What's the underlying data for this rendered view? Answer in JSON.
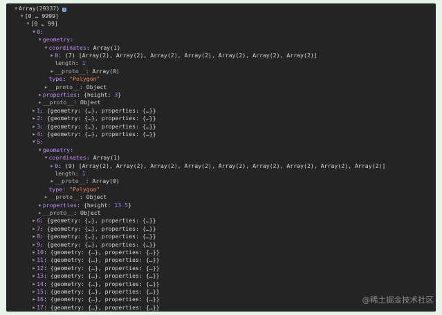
{
  "root_label": "Array(29337)",
  "watermark": "@稀土掘金技术社区",
  "rows": [
    {
      "ind": 0,
      "tri": "open",
      "spans": [
        {
          "t": "Array(29337)",
          "c": "key"
        }
      ],
      "icon": true
    },
    {
      "ind": 1,
      "tri": "open",
      "spans": [
        {
          "t": "[0 … 9999]",
          "c": "key"
        }
      ]
    },
    {
      "ind": 2,
      "tri": "open",
      "spans": [
        {
          "t": "[0 … 99]",
          "c": "key"
        }
      ]
    },
    {
      "ind": 3,
      "tri": "open",
      "spans": [
        {
          "t": "0:",
          "c": "purple"
        }
      ]
    },
    {
      "ind": 4,
      "tri": "open",
      "spans": [
        {
          "t": "geometry:",
          "c": "purple"
        }
      ]
    },
    {
      "ind": 5,
      "tri": "open",
      "spans": [
        {
          "t": "coordinates",
          "c": "purple"
        },
        {
          "t": ": Array(1)",
          "c": "key"
        }
      ]
    },
    {
      "ind": 6,
      "tri": "closed",
      "spans": [
        {
          "t": "0",
          "c": "purple"
        },
        {
          "t": ": (7) [Array(2), Array(2), Array(2), Array(2), Array(2), Array(2), Array(2)]",
          "c": "key"
        }
      ]
    },
    {
      "ind": 6,
      "tri": "none",
      "spans": [
        {
          "t": "length",
          "c": "dim"
        },
        {
          "t": ": ",
          "c": "key"
        },
        {
          "t": "1",
          "c": "num"
        }
      ]
    },
    {
      "ind": 6,
      "tri": "closed",
      "spans": [
        {
          "t": "__proto__",
          "c": "dim"
        },
        {
          "t": ": Array(0)",
          "c": "key"
        }
      ]
    },
    {
      "ind": 5,
      "tri": "none",
      "spans": [
        {
          "t": "type",
          "c": "purple"
        },
        {
          "t": ": ",
          "c": "key"
        },
        {
          "t": "\"Polygon\"",
          "c": "str"
        }
      ]
    },
    {
      "ind": 5,
      "tri": "closed",
      "spans": [
        {
          "t": "__proto__",
          "c": "dim"
        },
        {
          "t": ": Object",
          "c": "key"
        }
      ]
    },
    {
      "ind": 4,
      "tri": "closed",
      "spans": [
        {
          "t": "properties",
          "c": "purple"
        },
        {
          "t": ": {height: ",
          "c": "key"
        },
        {
          "t": "3",
          "c": "num"
        },
        {
          "t": "}",
          "c": "key"
        }
      ]
    },
    {
      "ind": 4,
      "tri": "closed",
      "spans": [
        {
          "t": "__proto__",
          "c": "dim"
        },
        {
          "t": ": Object",
          "c": "key"
        }
      ]
    },
    {
      "ind": 3,
      "tri": "closed",
      "spans": [
        {
          "t": "1",
          "c": "purple"
        },
        {
          "t": ": {geometry: {…}, properties: {…}}",
          "c": "key"
        }
      ]
    },
    {
      "ind": 3,
      "tri": "closed",
      "spans": [
        {
          "t": "2",
          "c": "purple"
        },
        {
          "t": ": {geometry: {…}, properties: {…}}",
          "c": "key"
        }
      ]
    },
    {
      "ind": 3,
      "tri": "closed",
      "spans": [
        {
          "t": "3",
          "c": "purple"
        },
        {
          "t": ": {geometry: {…}, properties: {…}}",
          "c": "key"
        }
      ]
    },
    {
      "ind": 3,
      "tri": "closed",
      "spans": [
        {
          "t": "4",
          "c": "purple"
        },
        {
          "t": ": {geometry: {…}, properties: {…}}",
          "c": "key"
        }
      ]
    },
    {
      "ind": 3,
      "tri": "open",
      "spans": [
        {
          "t": "5:",
          "c": "purple"
        }
      ]
    },
    {
      "ind": 4,
      "tri": "open",
      "spans": [
        {
          "t": "geometry:",
          "c": "purple"
        }
      ]
    },
    {
      "ind": 5,
      "tri": "open",
      "spans": [
        {
          "t": "coordinates",
          "c": "purple"
        },
        {
          "t": ": Array(1)",
          "c": "key"
        }
      ]
    },
    {
      "ind": 6,
      "tri": "closed",
      "spans": [
        {
          "t": "0",
          "c": "purple"
        },
        {
          "t": ": (9) [Array(2), Array(2), Array(2), Array(2), Array(2), Array(2), Array(2), Array(2), Array(2)]",
          "c": "key"
        }
      ]
    },
    {
      "ind": 6,
      "tri": "none",
      "spans": [
        {
          "t": "length",
          "c": "dim"
        },
        {
          "t": ": ",
          "c": "key"
        },
        {
          "t": "1",
          "c": "num"
        }
      ]
    },
    {
      "ind": 6,
      "tri": "closed",
      "spans": [
        {
          "t": "__proto__",
          "c": "dim"
        },
        {
          "t": ": Array(0)",
          "c": "key"
        }
      ]
    },
    {
      "ind": 5,
      "tri": "none",
      "spans": [
        {
          "t": "type",
          "c": "purple"
        },
        {
          "t": ": ",
          "c": "key"
        },
        {
          "t": "\"Polygon\"",
          "c": "str"
        }
      ]
    },
    {
      "ind": 5,
      "tri": "closed",
      "spans": [
        {
          "t": "__proto__",
          "c": "dim"
        },
        {
          "t": ": Object",
          "c": "key"
        }
      ]
    },
    {
      "ind": 4,
      "tri": "closed",
      "spans": [
        {
          "t": "properties",
          "c": "purple"
        },
        {
          "t": ": {height: ",
          "c": "key"
        },
        {
          "t": "13.5",
          "c": "num"
        },
        {
          "t": "}",
          "c": "key"
        }
      ]
    },
    {
      "ind": 4,
      "tri": "closed",
      "spans": [
        {
          "t": "__proto__",
          "c": "dim"
        },
        {
          "t": ": Object",
          "c": "key"
        }
      ]
    },
    {
      "ind": 3,
      "tri": "closed",
      "spans": [
        {
          "t": "6",
          "c": "purple"
        },
        {
          "t": ": {geometry: {…}, properties: {…}}",
          "c": "key"
        }
      ]
    },
    {
      "ind": 3,
      "tri": "closed",
      "spans": [
        {
          "t": "7",
          "c": "purple"
        },
        {
          "t": ": {geometry: {…}, properties: {…}}",
          "c": "key"
        }
      ]
    },
    {
      "ind": 3,
      "tri": "closed",
      "spans": [
        {
          "t": "8",
          "c": "purple"
        },
        {
          "t": ": {geometry: {…}, properties: {…}}",
          "c": "key"
        }
      ]
    },
    {
      "ind": 3,
      "tri": "closed",
      "spans": [
        {
          "t": "9",
          "c": "purple"
        },
        {
          "t": ": {geometry: {…}, properties: {…}}",
          "c": "key"
        }
      ]
    },
    {
      "ind": 3,
      "tri": "closed",
      "spans": [
        {
          "t": "10",
          "c": "purple"
        },
        {
          "t": ": {geometry: {…}, properties: {…}}",
          "c": "key"
        }
      ]
    },
    {
      "ind": 3,
      "tri": "closed",
      "spans": [
        {
          "t": "11",
          "c": "purple"
        },
        {
          "t": ": {geometry: {…}, properties: {…}}",
          "c": "key"
        }
      ]
    },
    {
      "ind": 3,
      "tri": "closed",
      "spans": [
        {
          "t": "12",
          "c": "purple"
        },
        {
          "t": ": {geometry: {…}, properties: {…}}",
          "c": "key"
        }
      ]
    },
    {
      "ind": 3,
      "tri": "closed",
      "spans": [
        {
          "t": "13",
          "c": "purple"
        },
        {
          "t": ": {geometry: {…}, properties: {…}}",
          "c": "key"
        }
      ]
    },
    {
      "ind": 3,
      "tri": "closed",
      "spans": [
        {
          "t": "14",
          "c": "purple"
        },
        {
          "t": ": {geometry: {…}, properties: {…}}",
          "c": "key"
        }
      ]
    },
    {
      "ind": 3,
      "tri": "closed",
      "spans": [
        {
          "t": "15",
          "c": "purple"
        },
        {
          "t": ": {geometry: {…}, properties: {…}}",
          "c": "key"
        }
      ]
    },
    {
      "ind": 3,
      "tri": "closed",
      "spans": [
        {
          "t": "16",
          "c": "purple"
        },
        {
          "t": ": {geometry: {…}, properties: {…}}",
          "c": "key"
        }
      ]
    },
    {
      "ind": 3,
      "tri": "closed",
      "spans": [
        {
          "t": "17",
          "c": "purple"
        },
        {
          "t": ": {geometry: {…}, properties: {…}}",
          "c": "key"
        }
      ]
    }
  ]
}
